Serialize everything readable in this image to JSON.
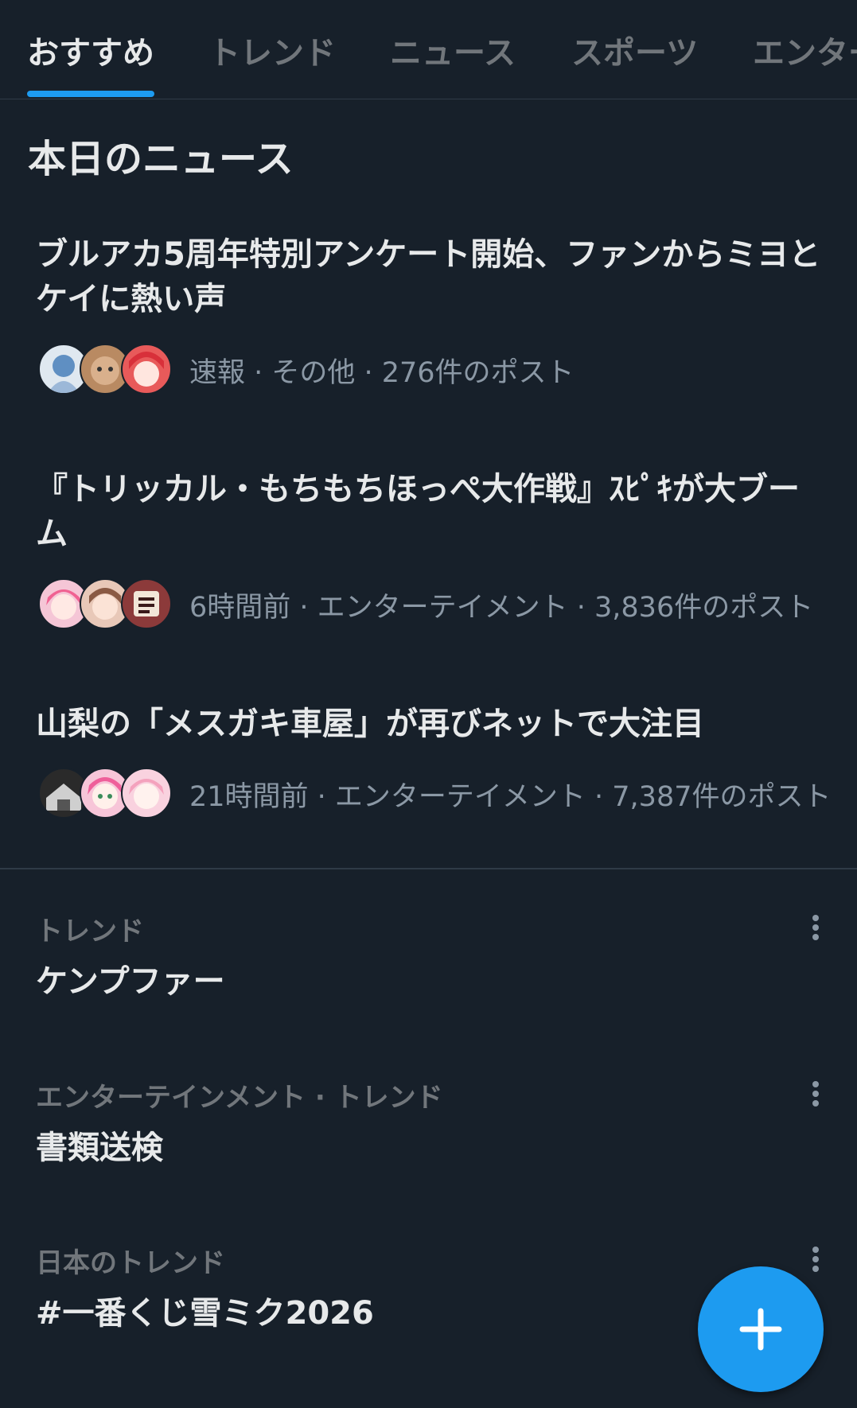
{
  "tabs": [
    {
      "label": "おすすめ",
      "active": true
    },
    {
      "label": "トレンド",
      "active": false
    },
    {
      "label": "ニュース",
      "active": false
    },
    {
      "label": "スポーツ",
      "active": false
    },
    {
      "label": "エンター",
      "active": false
    }
  ],
  "news_section": {
    "title": "本日のニュース",
    "items": [
      {
        "headline": "ブルアカ5周年特別アンケート開始、ファンからミヨとケイに熱い声",
        "meta": "速報 · その他 · 276件のポスト"
      },
      {
        "headline": "『トリッカル・もちもちほっぺ大作戦』ｽﾋﾟｷが大ブーム",
        "meta": "6時間前 · エンターテイメント · 3,836件のポスト"
      },
      {
        "headline": "山梨の「メスガキ車屋」が再びネットで大注目",
        "meta": "21時間前 · エンターテイメント · 7,387件のポスト"
      }
    ]
  },
  "trends": [
    {
      "context": "トレンド",
      "name": "ケンプファー"
    },
    {
      "context": "エンターテインメント · トレンド",
      "name": "書類送検"
    },
    {
      "context": "日本のトレンド",
      "name": "#一番くじ雪ミク2026"
    }
  ],
  "icons": {
    "more": "more-vertical-icon",
    "compose": "plus-icon"
  },
  "colors": {
    "background": "#17202a",
    "accent": "#1d9bf0",
    "text_primary": "#e7e9ea",
    "text_secondary": "#8b98a5"
  }
}
